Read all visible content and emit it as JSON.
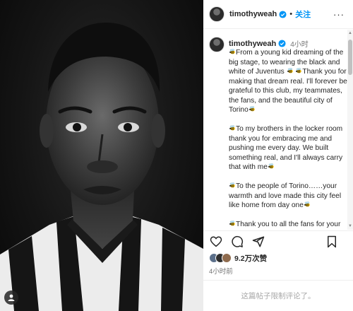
{
  "post": {
    "username": "timothyweah",
    "follow_label": "关注",
    "dot": "•",
    "more_label": "···",
    "caption_time": "4小时",
    "caption_paragraphs": [
      [
        "🐝",
        "From a young kid dreaming of the big stage, to wearing the black and white of Juventus ",
        "🐝",
        " ",
        "🐝",
        "Thank you for making that dream real. I'll forever be grateful to this club, my teammates, the fans, and the beautiful city of Torino",
        "🐝"
      ],
      [
        "🐝",
        "To my brothers in the locker room thank you for embracing me and pushing me every day. We built something real, and I'll always carry that with me",
        "🐝"
      ],
      [
        "🐝",
        "To the people of Torino……your warmth and love made this city feel like home from day one",
        "🐝"
      ],
      [
        "🐝",
        "Thank you to all the fans for your support, your energy, and belief in me"
      ]
    ],
    "likes": "9.2万次赞",
    "post_time": "4小时前",
    "comments_restricted": "这篇帖子限制评论了。"
  },
  "icons": {
    "verified": "verified-badge-icon",
    "heart": "heart-icon",
    "comment": "comment-icon",
    "share": "share-icon",
    "bookmark": "bookmark-icon",
    "tag": "tag-user-icon"
  },
  "colors": {
    "follow": "#0095f6",
    "verified": "#0095f6",
    "secondary_text": "#737373",
    "disabled_text": "#a8a8a8"
  }
}
